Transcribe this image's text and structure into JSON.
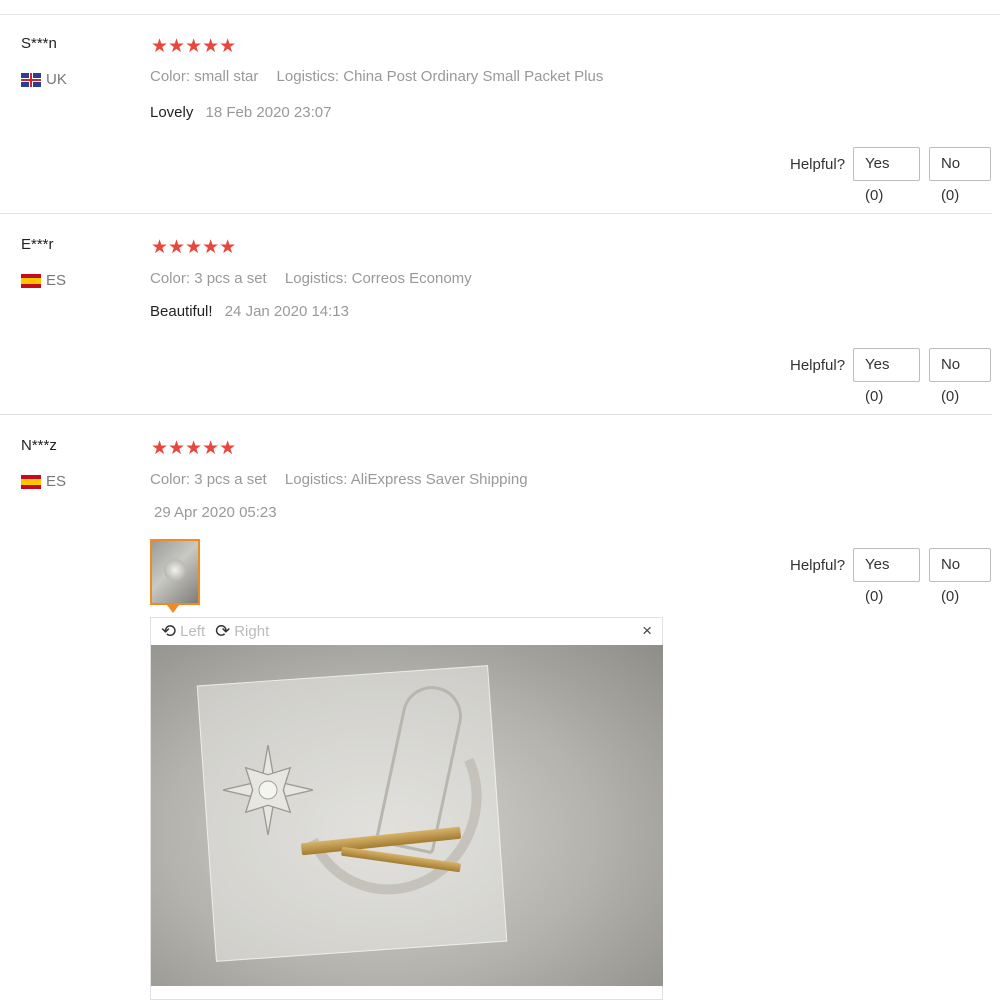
{
  "reviews": [
    {
      "user": "S***n",
      "country": "UK",
      "stars": "★★★★★",
      "color_label": "Color:",
      "color_value": "small star",
      "logistics_label": "Logistics:",
      "logistics_value": "China Post Ordinary Small Packet Plus",
      "text": "Lovely",
      "date": "18 Feb 2020 23:07",
      "helpful_label": "Helpful?",
      "yes_label": "Yes (0)",
      "no_label": "No (0)"
    },
    {
      "user": "E***r",
      "country": "ES",
      "stars": "★★★★★",
      "color_label": "Color:",
      "color_value": "3 pcs a set",
      "logistics_label": "Logistics:",
      "logistics_value": "Correos Economy",
      "text": "Beautiful!",
      "date": "24 Jan 2020 14:13",
      "helpful_label": "Helpful?",
      "yes_label": "Yes (0)",
      "no_label": "No (0)"
    },
    {
      "user": "N***z",
      "country": "ES",
      "stars": "★★★★★",
      "color_label": "Color:",
      "color_value": "3 pcs a set",
      "logistics_label": "Logistics:",
      "logistics_value": "AliExpress Saver Shipping",
      "text": "",
      "date": "29 Apr 2020 05:23",
      "helpful_label": "Helpful?",
      "yes_label": "Yes (0)",
      "no_label": "No (0)"
    }
  ],
  "viewer": {
    "rotate_left_label": "Left",
    "rotate_right_label": "Right",
    "close_icon": "×"
  },
  "colors": {
    "star": "#e8473b",
    "thumb_border": "#f08a24"
  }
}
